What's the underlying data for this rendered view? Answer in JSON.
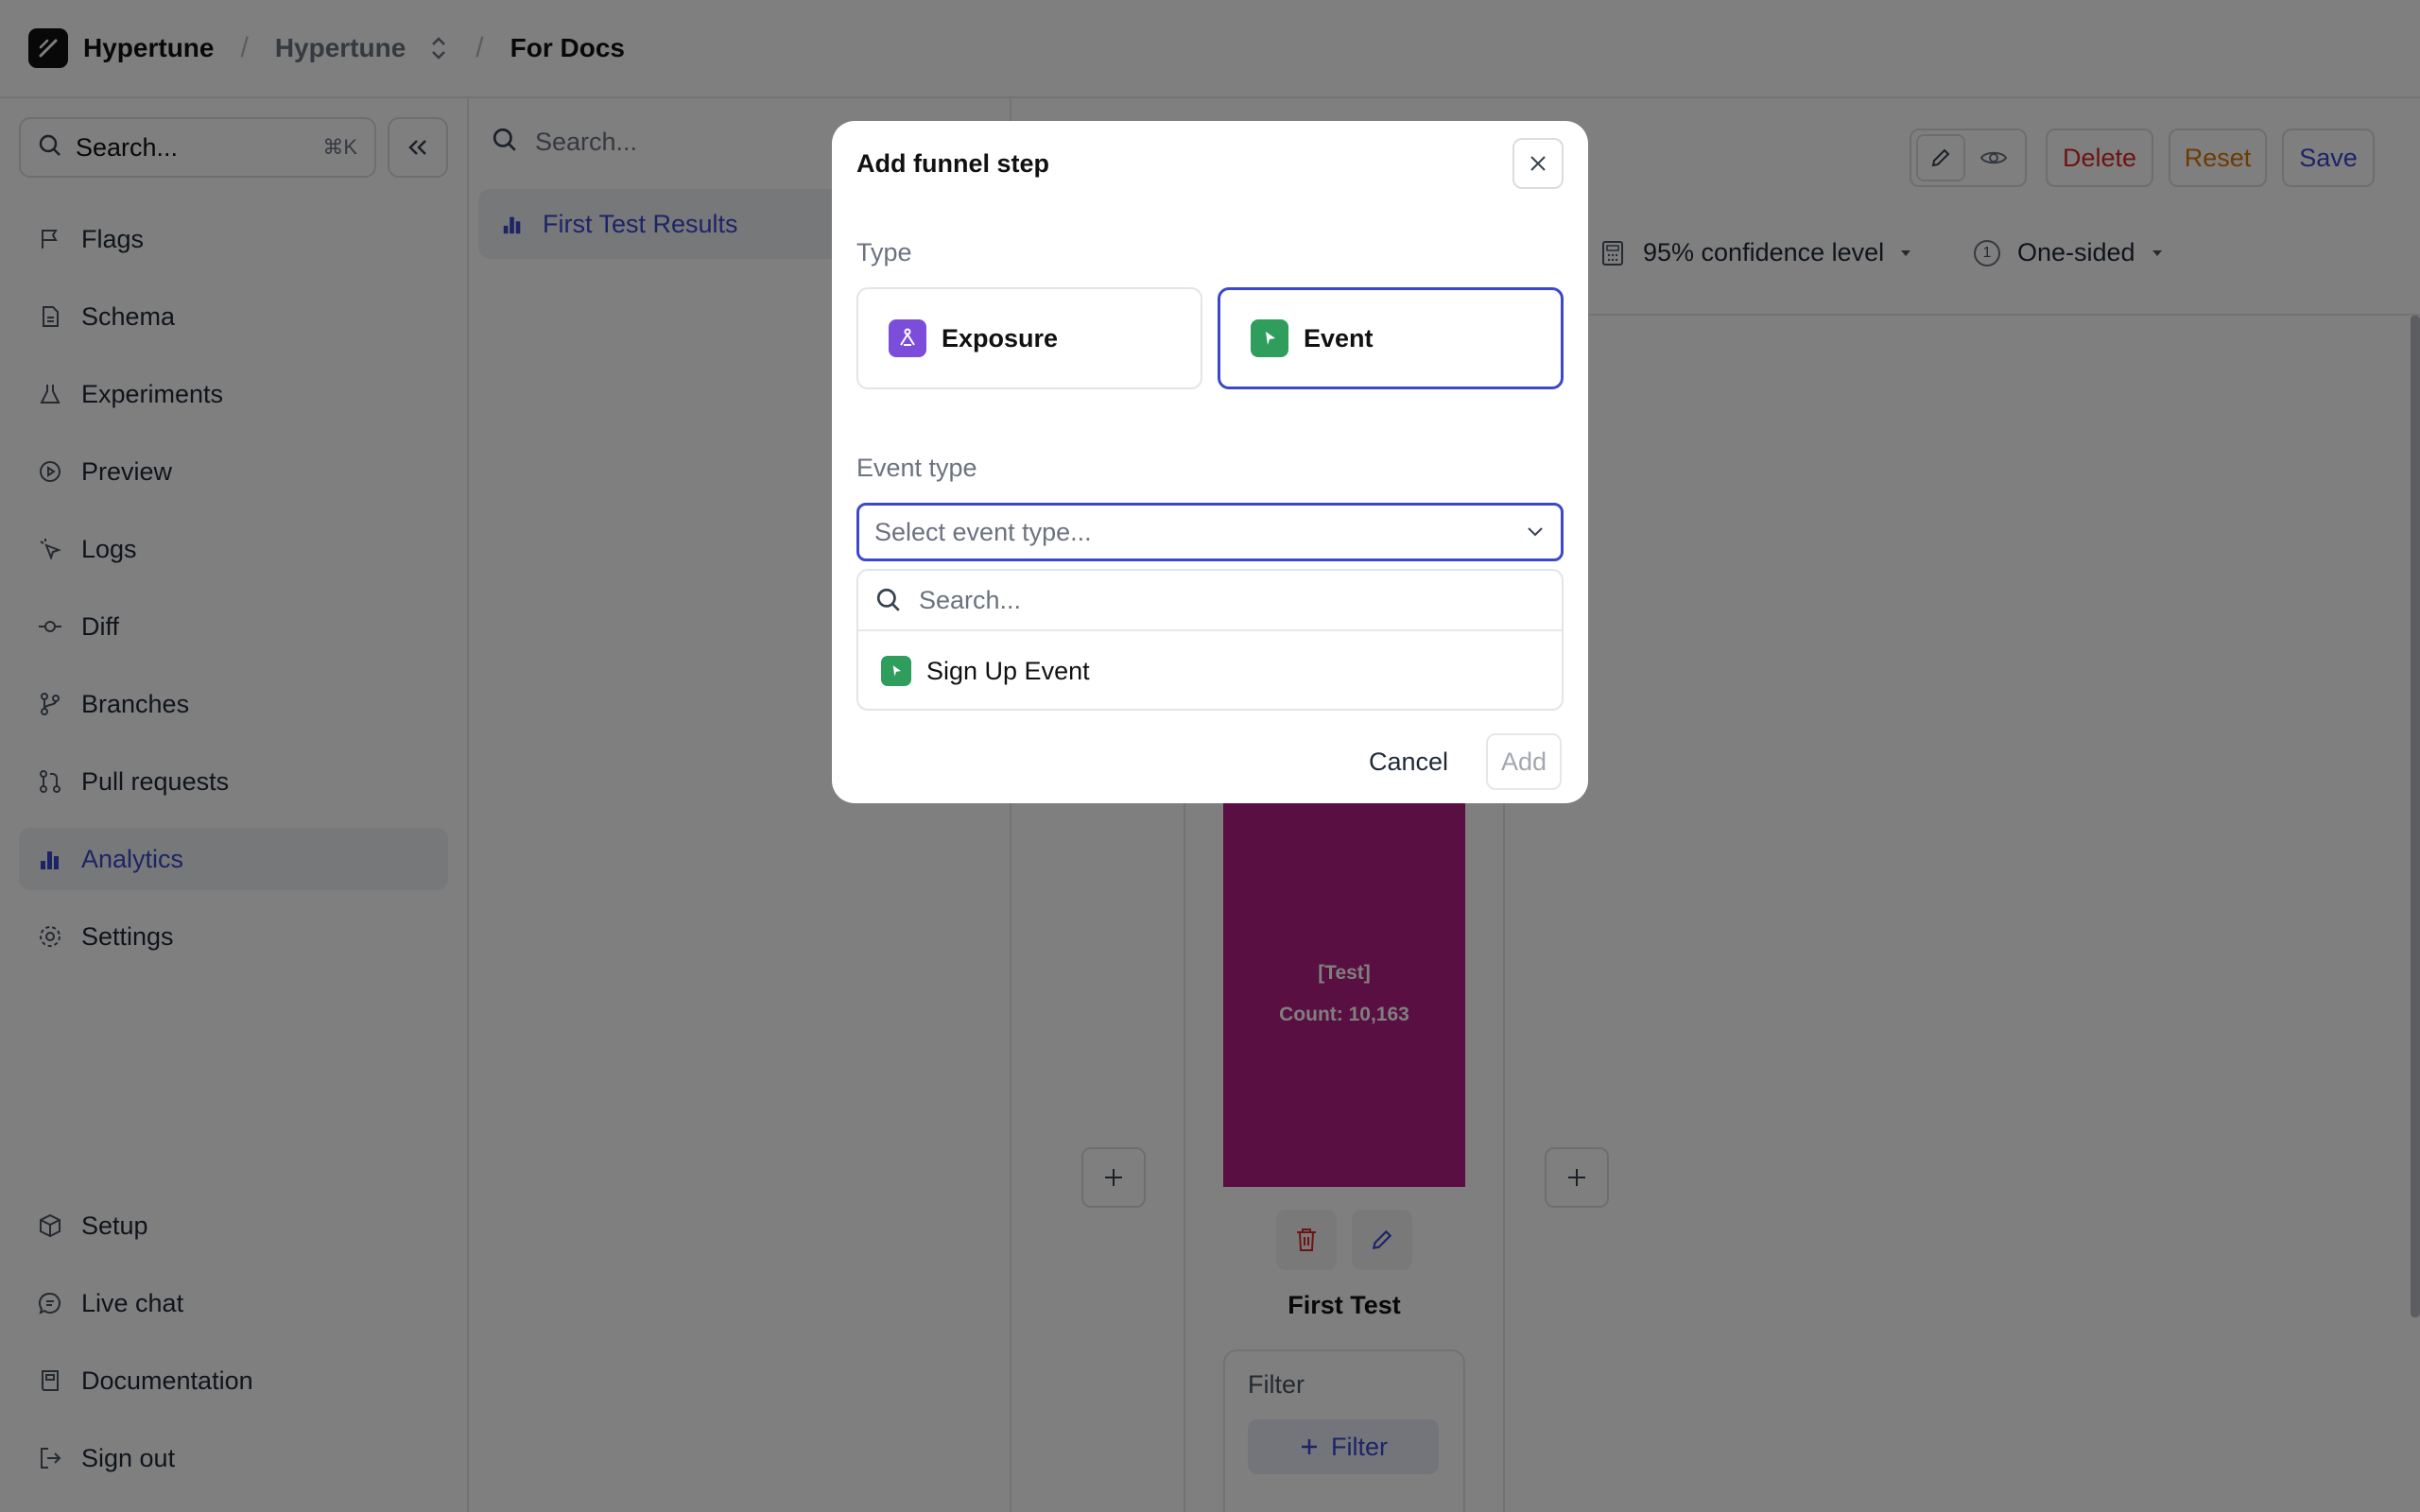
{
  "header": {
    "brand": "Hypertune",
    "separator": "/",
    "project": "Hypertune",
    "page": "For Docs"
  },
  "sidebar": {
    "search_placeholder": "Search...",
    "shortcut": "⌘K",
    "items": [
      {
        "label": "Flags",
        "icon": "flag-icon"
      },
      {
        "label": "Schema",
        "icon": "document-icon"
      },
      {
        "label": "Experiments",
        "icon": "flask-icon"
      },
      {
        "label": "Preview",
        "icon": "play-circle-icon"
      },
      {
        "label": "Logs",
        "icon": "cursor-icon"
      },
      {
        "label": "Diff",
        "icon": "commit-icon"
      },
      {
        "label": "Branches",
        "icon": "branch-icon"
      },
      {
        "label": "Pull requests",
        "icon": "pull-request-icon"
      },
      {
        "label": "Analytics",
        "icon": "bar-chart-icon",
        "active": true
      },
      {
        "label": "Settings",
        "icon": "gear-icon"
      }
    ],
    "bottom_items": [
      {
        "label": "Setup",
        "icon": "box-icon"
      },
      {
        "label": "Live chat",
        "icon": "chat-icon"
      },
      {
        "label": "Documentation",
        "icon": "book-icon"
      },
      {
        "label": "Sign out",
        "icon": "sign-out-icon"
      }
    ]
  },
  "list": {
    "search_placeholder": "Search...",
    "items": [
      {
        "label": "First Test Results",
        "icon": "bar-chart-icon"
      }
    ]
  },
  "toolbar": {
    "delete": "Delete",
    "reset": "Reset",
    "save": "Save"
  },
  "options": {
    "confidence": "95% confidence level",
    "sidedness": "One-sided",
    "sidedness_badge": "1"
  },
  "funnel": {
    "bar_label": "[Test]",
    "bar_count": "Count: 10,163",
    "bar_fill_fraction": 1.0,
    "variant": "First Test",
    "filter_label": "Filter",
    "filter_button": "Filter"
  },
  "modal": {
    "title": "Add funnel step",
    "type_label": "Type",
    "types": [
      {
        "label": "Exposure",
        "icon": "exposure-icon",
        "selected": false
      },
      {
        "label": "Event",
        "icon": "event-icon",
        "selected": true
      }
    ],
    "event_type_label": "Event type",
    "select_placeholder": "Select event type...",
    "dropdown_search_placeholder": "Search...",
    "options": [
      {
        "label": "Sign Up Event",
        "icon": "event-icon"
      }
    ],
    "cancel": "Cancel",
    "add": "Add"
  },
  "colors": {
    "accent": "#3b48cc",
    "delete": "#dc2626",
    "reset": "#d97706",
    "bar": "#b21e83",
    "exposure": "#7c4ddb",
    "event": "#2f9e5c"
  }
}
